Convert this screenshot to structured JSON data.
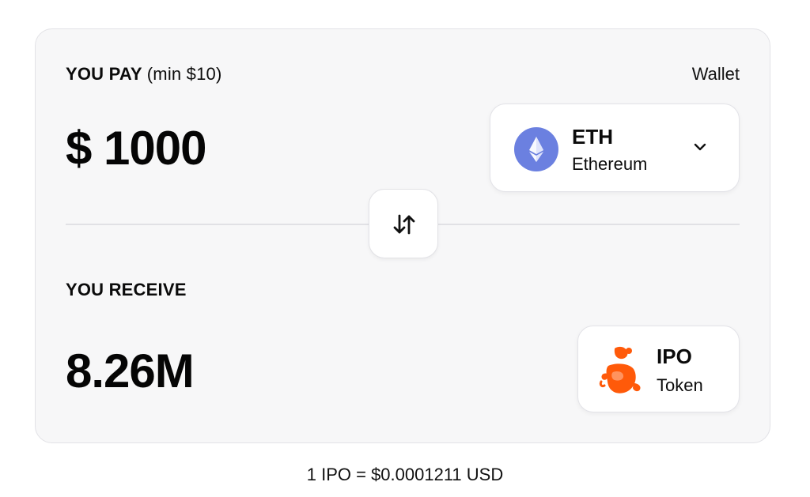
{
  "pay": {
    "label": "YOU PAY",
    "min_note": "(min $10)",
    "wallet_label": "Wallet",
    "amount": "$ 1000",
    "token": {
      "symbol": "ETH",
      "name": "Ethereum",
      "icon": "ethereum-icon",
      "color": "#6b80e0"
    }
  },
  "swap": {
    "icon": "swap-arrows-icon"
  },
  "receive": {
    "label": "YOU RECEIVE",
    "amount": "8.26M",
    "token": {
      "symbol": "IPO",
      "name": "Token",
      "icon": "ipo-mascot-icon",
      "color": "#ff5a0a"
    }
  },
  "rate": "1 IPO = $0.0001211 USD"
}
